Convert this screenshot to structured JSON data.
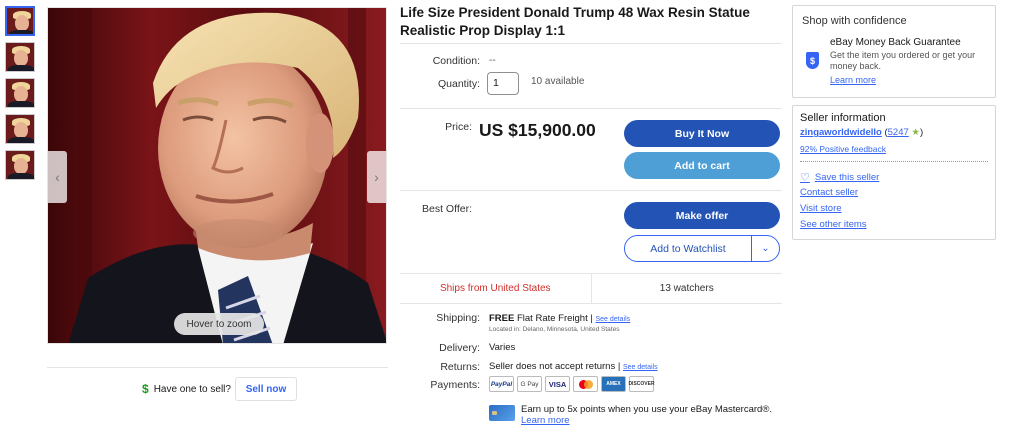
{
  "listing": {
    "title": "Life Size President Donald Trump 48 Wax Resin Statue Realistic Prop Display 1:1",
    "condition_label": "Condition:",
    "condition_value": "--",
    "quantity_label": "Quantity:",
    "quantity_value": "1",
    "available": "10 available",
    "price_label": "Price:",
    "price": "US $15,900.00",
    "best_offer_label": "Best Offer:"
  },
  "gallery": {
    "hover_zoom": "Hover to zoom",
    "prev_icon": "chevron-left-icon",
    "next_icon": "chevron-right-icon",
    "thumbnail_count": 5
  },
  "buttons": {
    "buy_now": "Buy It Now",
    "add_to_cart": "Add to cart",
    "make_offer": "Make offer",
    "add_to_watchlist": "Add to Watchlist"
  },
  "stats": {
    "ships_from": "Ships from United States",
    "watchers": "13 watchers"
  },
  "details": {
    "shipping_label": "Shipping:",
    "shipping_value": "FREE",
    "shipping_method": "Flat Rate Freight |",
    "see_details": "See details",
    "located_in": "Located in: Delano, Minnesota, United States",
    "delivery_label": "Delivery:",
    "delivery_value": "Varies",
    "returns_label": "Returns:",
    "returns_value": "Seller does not accept returns |",
    "payments_label": "Payments:"
  },
  "payments": {
    "paypal": "PayPal",
    "gpay": "G Pay",
    "visa": "VISA",
    "amex": "AMEX",
    "discover": "DISCOVER"
  },
  "promo": {
    "text": "Earn up to 5x points when you use your eBay Mastercard®.",
    "link": "Learn more"
  },
  "sell": {
    "question": "Have one to sell?",
    "button": "Sell now"
  },
  "confidence": {
    "title": "Shop with confidence",
    "guarantee_title": "eBay Money Back Guarantee",
    "guarantee_desc": "Get the item you ordered or get your money back.",
    "learn_more": "Learn more"
  },
  "seller": {
    "title": "Seller information",
    "name": "zingaworldwidello",
    "score": "5247",
    "feedback": "92% Positive feedback",
    "save": "Save this seller",
    "contact": "Contact seller",
    "visit": "Visit store",
    "other": "See other items"
  },
  "colors": {
    "primary_button": "#2353b5",
    "secondary_button": "#4d9fd6",
    "link": "#3665f3",
    "ships_red": "#d0302b"
  }
}
